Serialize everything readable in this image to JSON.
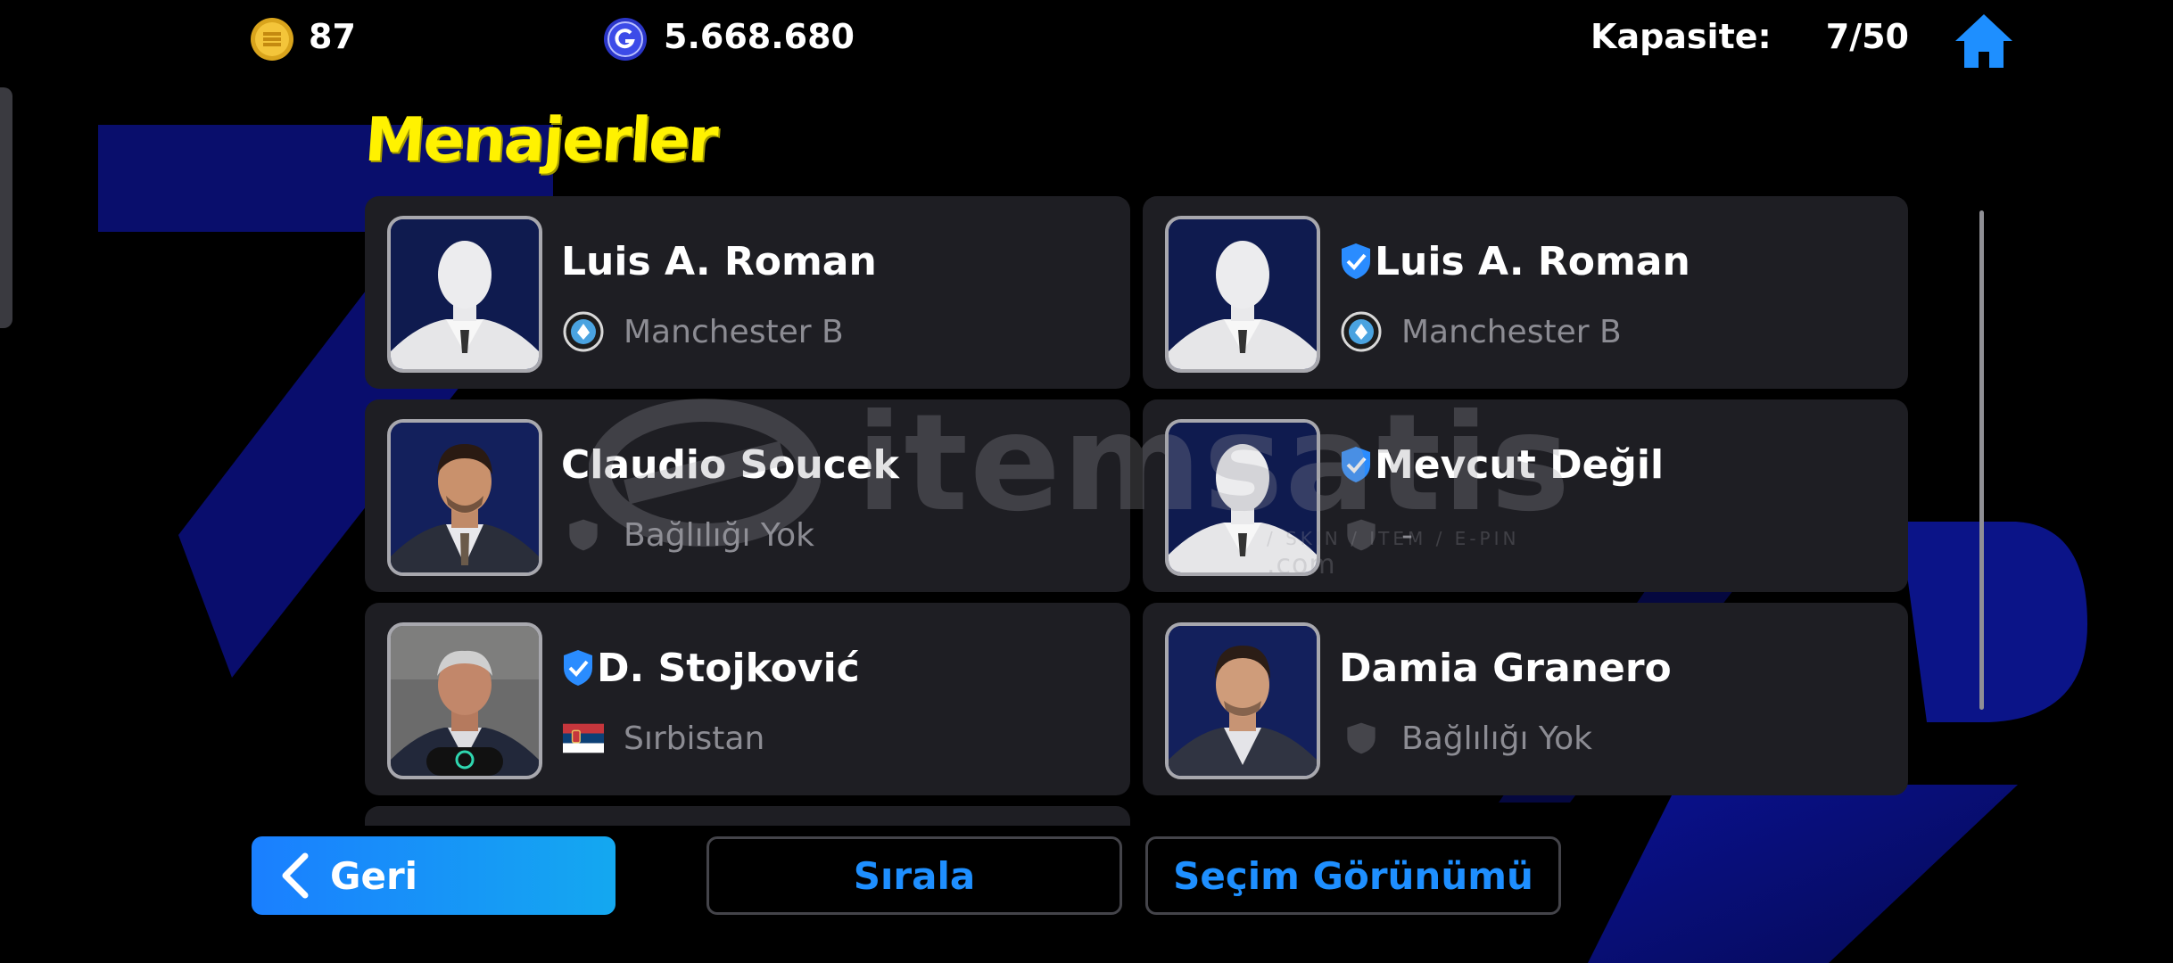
{
  "topbar": {
    "coins": "87",
    "gp": "5.668.680",
    "capacity_label": "Kapasite:",
    "capacity_value": "7/50"
  },
  "title": "Menajerler",
  "managers": [
    {
      "name": "Luis A. Roman",
      "team": "Manchester B",
      "verified": false,
      "team_icon": "club-badge-icon",
      "portrait": "silhouette"
    },
    {
      "name": "Luis A. Roman",
      "team": "Manchester B",
      "verified": true,
      "team_icon": "club-badge-icon",
      "portrait": "silhouette"
    },
    {
      "name": "Claudio Soucek",
      "team": "Bağlılığı Yok",
      "verified": false,
      "team_icon": "no-affiliation-shield-icon",
      "portrait": "photo"
    },
    {
      "name": "Mevcut Değil",
      "team": "-",
      "verified": true,
      "team_icon": "no-affiliation-shield-icon",
      "portrait": "silhouette"
    },
    {
      "name": "D. Stojković",
      "team": "Sırbistan",
      "verified": true,
      "team_icon": "serbia-flag-icon",
      "portrait": "photo"
    },
    {
      "name": "Damia Granero",
      "team": "Bağlılığı Yok",
      "verified": false,
      "team_icon": "no-affiliation-shield-icon",
      "portrait": "photo"
    }
  ],
  "watermark": {
    "text": "itemsatis",
    "sub": "/ SKIN / ITEM / E-PIN",
    "domain": ".com"
  },
  "buttons": {
    "back": "Geri",
    "sort": "Sırala",
    "view": "Seçim Görünümü"
  },
  "colors": {
    "title": "#fff200",
    "accent_blue": "#1e8fff",
    "card_bg": "#1e1e23",
    "muted_text": "#8c8c93"
  }
}
